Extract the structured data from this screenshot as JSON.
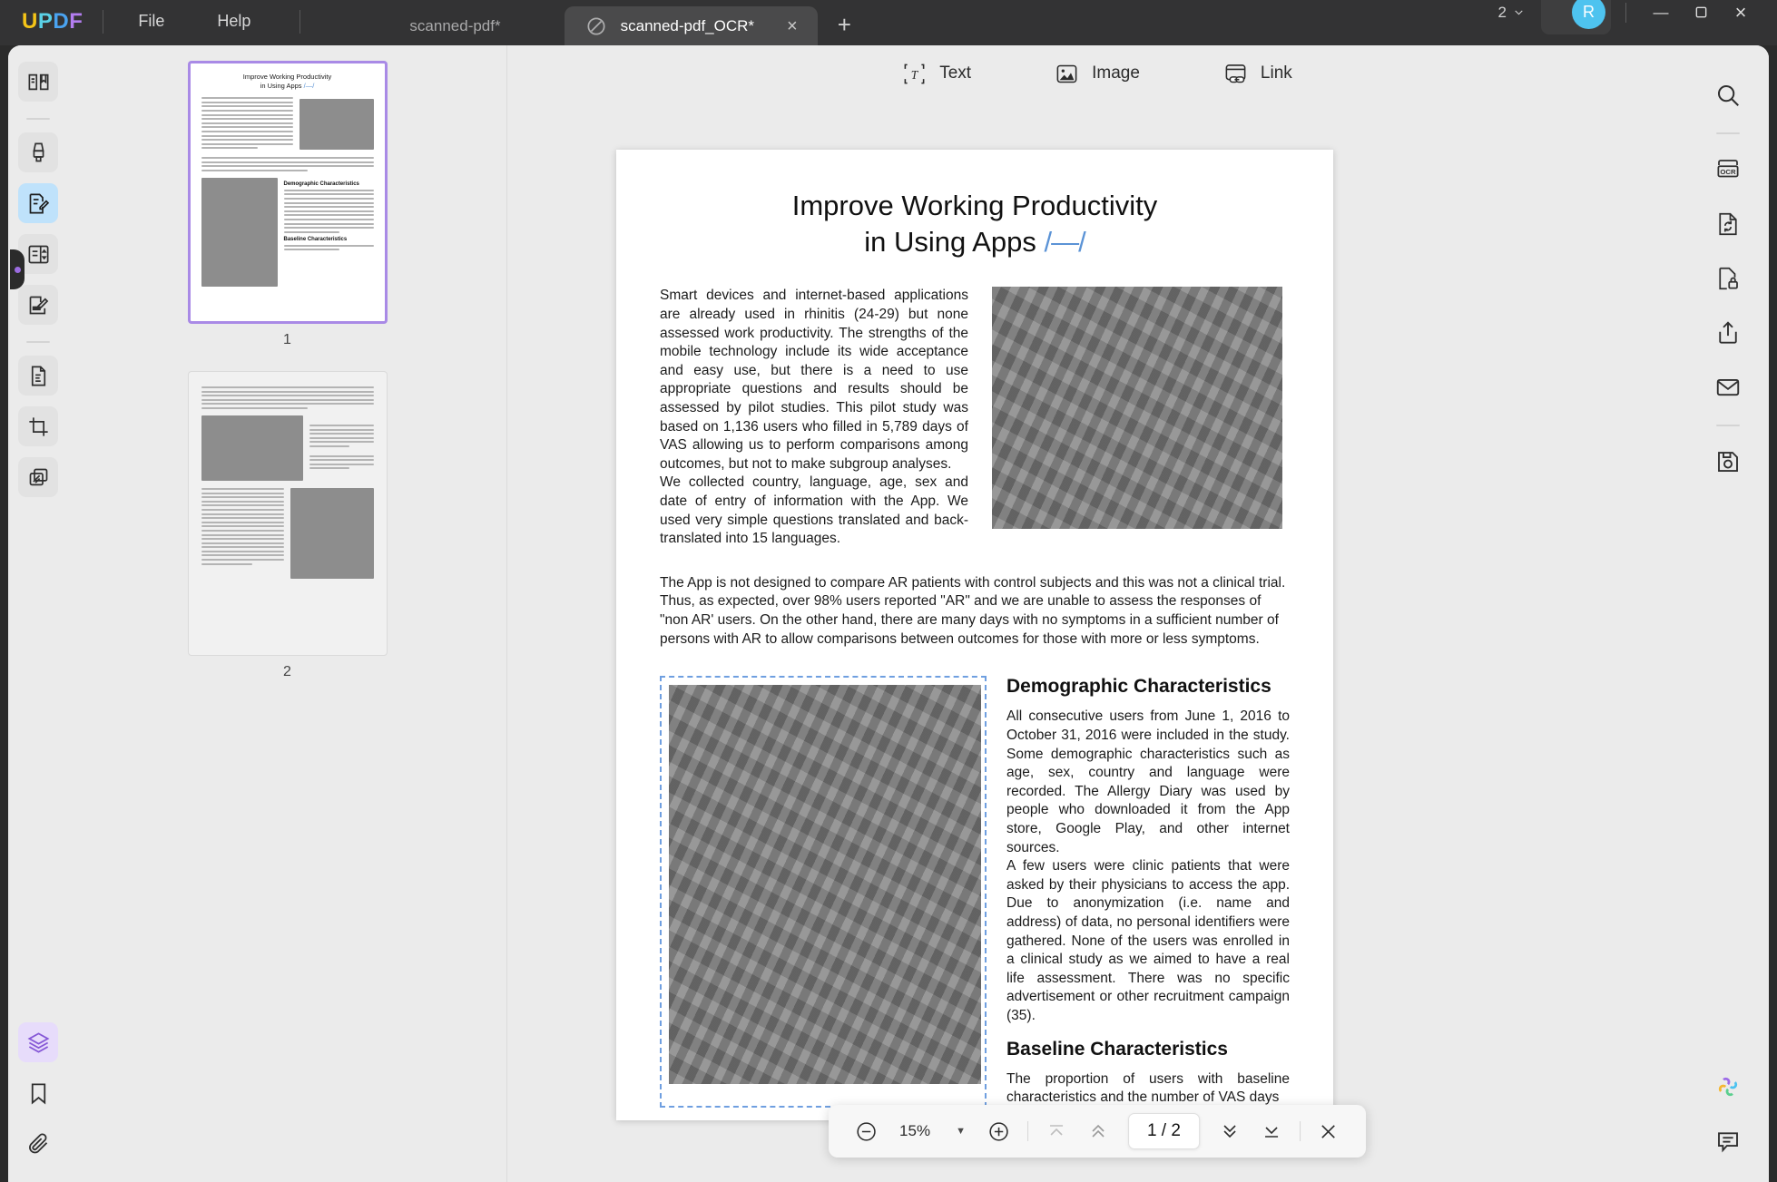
{
  "app": {
    "logo_letters": [
      "U",
      "P",
      "D",
      "F"
    ],
    "menus": [
      {
        "label": "File",
        "name": "menu-file"
      },
      {
        "label": "Help",
        "name": "menu-help"
      }
    ],
    "tabs": [
      {
        "label": "scanned-pdf*",
        "active": false,
        "name": "tab-scanned-pdf"
      },
      {
        "label": "scanned-pdf_OCR*",
        "active": true,
        "name": "tab-scanned-pdf-ocr"
      }
    ],
    "new_tab_glyph": "+",
    "tab_close_glyph": "×",
    "page_count_indicator": "2",
    "avatar_initial": "R",
    "window_controls": {
      "minimize": "—",
      "maximize": "□",
      "close": "×"
    },
    "accent_blue": "#4ec3ef",
    "accent_purple": "#9b6ce0"
  },
  "left_rail": {
    "items": [
      {
        "name": "sidebar-reader-icon",
        "label": "Reader",
        "state": "soft"
      },
      {
        "name": "sidebar-annotate-icon",
        "label": "Annotate",
        "state": "soft"
      },
      {
        "name": "sidebar-edit-pdf-icon",
        "label": "Edit PDF",
        "state": "selected"
      },
      {
        "name": "sidebar-page-edit-icon",
        "label": "Organize Pages",
        "state": "soft"
      },
      {
        "name": "sidebar-form-icon",
        "label": "Form",
        "state": "soft"
      },
      {
        "name": "sidebar-convert-doc-icon",
        "label": "Convert",
        "state": "soft"
      },
      {
        "name": "sidebar-crop-icon",
        "label": "Crop",
        "state": "soft"
      },
      {
        "name": "sidebar-batch-icon",
        "label": "Batch",
        "state": "soft"
      }
    ],
    "bottom_items": [
      {
        "name": "sidebar-layers-icon",
        "label": "Layers",
        "state": "selected-purple"
      },
      {
        "name": "sidebar-bookmark-icon",
        "label": "Bookmarks",
        "state": "plain"
      },
      {
        "name": "sidebar-attachment-icon",
        "label": "Attachments",
        "state": "plain"
      }
    ]
  },
  "right_rail": {
    "items": [
      {
        "name": "search-icon",
        "label": "Search"
      },
      {
        "name": "ocr-icon",
        "label": "OCR"
      },
      {
        "name": "convert-icon",
        "label": "Convert"
      },
      {
        "name": "protect-icon",
        "label": "Protect"
      },
      {
        "name": "share-icon",
        "label": "Share"
      },
      {
        "name": "email-icon",
        "label": "Email"
      },
      {
        "name": "save-icon",
        "label": "Save"
      }
    ],
    "bottom_items": [
      {
        "name": "ai-assistant-icon",
        "label": "AI Assistant"
      },
      {
        "name": "comment-icon",
        "label": "Comment"
      }
    ]
  },
  "edit_toolbar": [
    {
      "label": "Text",
      "name": "edit-text-tool",
      "icon": "text-icon"
    },
    {
      "label": "Image",
      "name": "edit-image-tool",
      "icon": "image-icon"
    },
    {
      "label": "Link",
      "name": "edit-link-tool",
      "icon": "link-icon"
    }
  ],
  "thumbnails": [
    {
      "number": "1",
      "active": true
    },
    {
      "number": "2",
      "active": false
    }
  ],
  "document": {
    "title_line1": "Improve Working Productivity",
    "title_line2": "in Using Apps",
    "title_mark": "/—/",
    "para1": "Smart devices and internet-based applications are already used in rhinitis (24-29) but none assessed work productivity. The strengths of the mobile technology include its wide acceptance and easy use, but there is a need to use appropriate questions and results should be assessed by pilot studies. This pilot study was based on 1,136 users who filled in 5,789 days of VAS allowing us to perform comparisons among outcomes, but not to make subgroup analyses.",
    "para2": "We collected country, language, age, sex and date of entry of information with the App. We used very simple questions translated and back-translated into 15 languages.",
    "para3": "The App is not designed to compare AR patients with control subjects and this was not a clinical trial. Thus, as expected, over 98% users reported \"AR\" and we are unable to assess the responses of \"non AR' users. On the other hand, there are many days with no symptoms in a sufficient number of persons with AR to allow comparisons between outcomes for those with more or less symptoms.",
    "heading_demographic": "Demographic Characteristics",
    "demo_para1": "All consecutive users from June 1, 2016 to October 31, 2016 were included in the study. Some demographic characteristics such as age, sex, country and language were recorded. The Allergy Diary was used by people who downloaded it from the App store, Google Play, and other internet sources.",
    "demo_para2": "A few users were clinic patients that were asked by their physicians to access the app. Due to anonymization (i.e. name and address) of data, no personal identifiers were gathered. None of the users was enrolled in a clinical study as we aimed to have a real life assessment. There was no specific advertisement or other   recruitment campaign (35).",
    "heading_baseline": "Baseline Characteristics",
    "baseline_para": "The proportion of users with baseline characteristics and the number of VAS days",
    "image1_alt": "meeting-room-photo",
    "image2_alt": "students-with-laptops-photo-selected"
  },
  "bottom_bar": {
    "zoom_out": "⊖",
    "zoom_value": "15%",
    "zoom_caret": "▼",
    "zoom_in": "⊕",
    "first_page": "first-page",
    "prev_page": "previous-page",
    "page_indicator": "1 / 2",
    "next_page": "next-page",
    "last_page": "last-page",
    "close": "×"
  }
}
